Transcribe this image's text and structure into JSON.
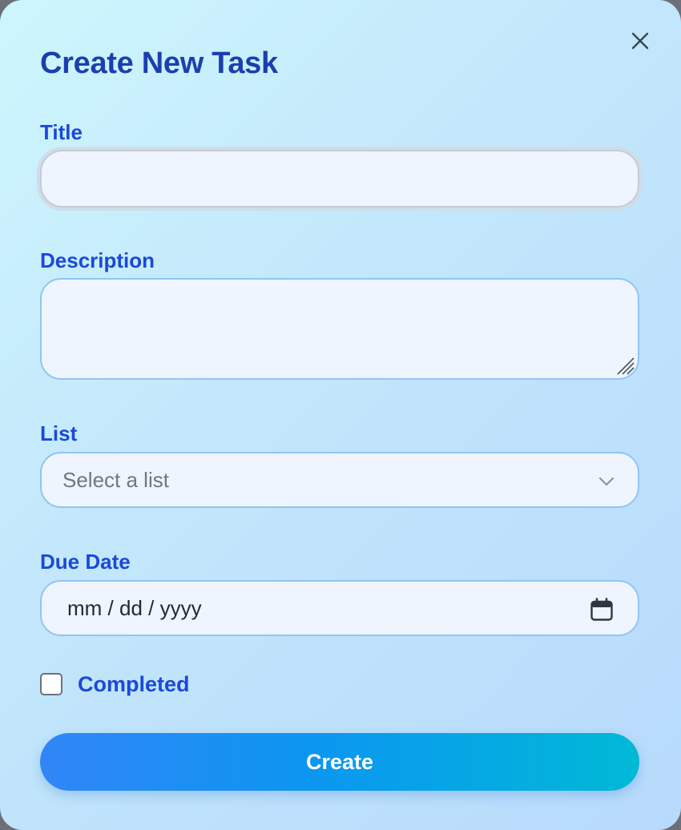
{
  "dialog": {
    "title": "Create New Task",
    "close_icon": "close-icon"
  },
  "form": {
    "title_label": "Title",
    "title_value": "",
    "description_label": "Description",
    "description_value": "",
    "list_label": "List",
    "list_placeholder": "Select a list",
    "due_date_label": "Due Date",
    "due_date_placeholder": "mm / dd / yyyy",
    "completed_label": "Completed",
    "completed_checked": false,
    "submit_label": "Create"
  },
  "icons": {
    "close": "close-icon",
    "chevron": "chevron-down-icon",
    "calendar": "calendar-icon",
    "resize": "resize-grip-icon"
  },
  "colors": {
    "title": "#1c3fae",
    "label": "#1a49d9",
    "field_bg": "#eef5fe",
    "field_border": "#93c4f3",
    "button_start": "#3186f6",
    "button_end": "#00b9d6"
  }
}
